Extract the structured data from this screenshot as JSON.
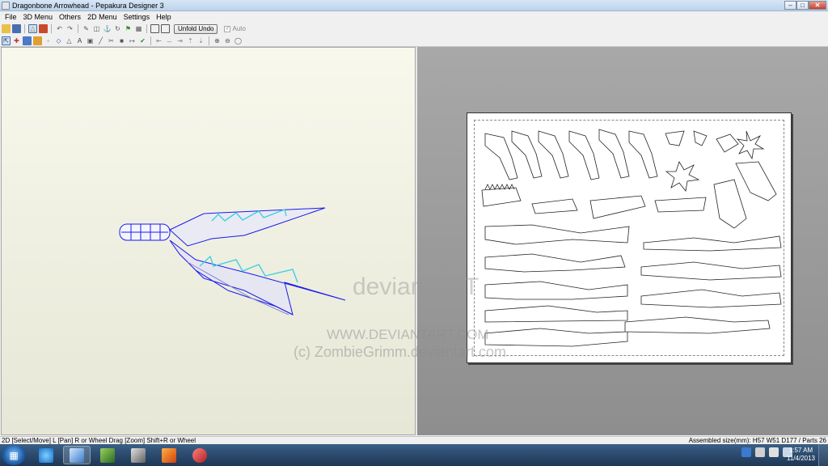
{
  "window": {
    "title": "Dragonbone Arrowhead - Pepakura Designer 3",
    "controls": {
      "minimize": "–",
      "maximize": "□",
      "close": "✕"
    }
  },
  "menu": [
    "File",
    "3D Menu",
    "Others",
    "2D Menu",
    "Settings",
    "Help"
  ],
  "toolbar": {
    "unfold_undo_label": "Unfold Undo",
    "auto_label": "Auto",
    "auto_checked": true
  },
  "watermark": {
    "logo_text": "deviantART",
    "site": "WWW.DEVIANTART.COM",
    "credit": "(c) ZombieGrimm.deviantart.com"
  },
  "status": {
    "left": "2D [Select/Move] L [Pan] R or Wheel Drag [Zoom] Shift+R or Wheel",
    "right": "Assembled size(mm): H57 W51 D177 / Parts 26"
  },
  "taskbar": {
    "apps": [
      "internet-explorer",
      "pepakura-designer",
      "terrain-app",
      "media-app",
      "paint-app",
      "3d-model-app"
    ],
    "clock_time": "1:57 AM",
    "clock_date": "11/4/2013"
  },
  "colors": {
    "model_outline": "#1a1aee",
    "model_accent": "#3fd0e0",
    "view2d_bg": "#9c9c9c",
    "view3d_bg": "#eeeee0"
  }
}
